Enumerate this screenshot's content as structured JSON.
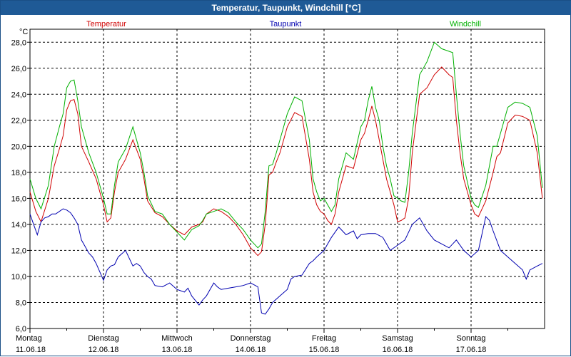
{
  "window": {
    "title": "Temperatur, Taupunkt, Windchill [°C]"
  },
  "colors": {
    "temperatur": "#d00000",
    "taupunkt": "#0000b0",
    "windchill": "#00b000",
    "titlebar": "#1f5a96",
    "grid": "#000000"
  },
  "chart_data": {
    "type": "line",
    "title": "Temperatur, Taupunkt, Windchill [°C]",
    "ylabel": "°C",
    "ylim": [
      6.0,
      29.0
    ],
    "xlim": [
      0,
      7
    ],
    "grid": true,
    "legend_placement": "top",
    "yticks": [
      "6,0",
      "8,0",
      "10,0",
      "12,0",
      "14,0",
      "16,0",
      "18,0",
      "20,0",
      "22,0",
      "24,0",
      "26,0",
      "28,0"
    ],
    "days": [
      {
        "name": "Montag",
        "date": "11.06.18"
      },
      {
        "name": "Dienstag",
        "date": "12.06.18"
      },
      {
        "name": "Mittwoch",
        "date": "13.06.18"
      },
      {
        "name": "Donnerstag",
        "date": "14.06.18"
      },
      {
        "name": "Freitag",
        "date": "15.06.18"
      },
      {
        "name": "Samstag",
        "date": "16.06.18"
      },
      {
        "name": "Sonntag",
        "date": "17.06.18"
      }
    ],
    "series": [
      {
        "name": "Temperatur",
        "x": [
          0,
          0.08,
          0.15,
          0.25,
          0.33,
          0.4,
          0.45,
          0.5,
          0.55,
          0.6,
          0.65,
          0.7,
          0.8,
          0.9,
          1.0,
          1.05,
          1.1,
          1.15,
          1.2,
          1.3,
          1.4,
          1.5,
          1.55,
          1.6,
          1.7,
          1.8,
          1.9,
          2.0,
          2.1,
          2.2,
          2.3,
          2.35,
          2.4,
          2.5,
          2.6,
          2.7,
          2.8,
          2.9,
          3.0,
          3.1,
          3.15,
          3.2,
          3.25,
          3.3,
          3.35,
          3.4,
          3.45,
          3.5,
          3.6,
          3.7,
          3.8,
          3.85,
          3.9,
          3.95,
          4.0,
          4.05,
          4.1,
          4.15,
          4.2,
          4.3,
          4.4,
          4.5,
          4.55,
          4.6,
          4.65,
          4.7,
          4.75,
          4.8,
          4.85,
          4.9,
          4.95,
          5.0,
          5.05,
          5.1,
          5.15,
          5.2,
          5.3,
          5.4,
          5.5,
          5.6,
          5.7,
          5.75,
          5.8,
          5.85,
          5.9,
          6.0,
          6.05,
          6.1,
          6.2,
          6.3,
          6.35,
          6.4,
          6.5,
          6.6,
          6.7,
          6.8,
          6.9,
          6.97
        ],
        "values": [
          16.5,
          15.0,
          14.2,
          16.0,
          18.5,
          19.8,
          20.8,
          22.8,
          23.5,
          23.6,
          22.5,
          20.0,
          18.8,
          17.5,
          15.5,
          14.2,
          14.5,
          16.5,
          18.0,
          19.0,
          20.5,
          19.0,
          17.5,
          15.8,
          14.9,
          14.6,
          14.0,
          13.5,
          13.2,
          13.8,
          14.0,
          14.2,
          14.8,
          15.2,
          15.0,
          14.6,
          14.0,
          13.2,
          12.2,
          11.6,
          11.9,
          14.0,
          17.8,
          18.0,
          18.8,
          19.5,
          20.5,
          21.5,
          22.6,
          22.3,
          19.0,
          16.5,
          15.5,
          15.0,
          14.8,
          14.3,
          14.0,
          14.8,
          16.5,
          18.5,
          18.3,
          20.5,
          21.0,
          22.0,
          23.1,
          22.0,
          20.5,
          19.0,
          17.5,
          16.5,
          15.5,
          14.2,
          14.3,
          14.5,
          16.0,
          19.5,
          24.0,
          24.5,
          25.5,
          26.1,
          25.5,
          25.3,
          22.0,
          19.5,
          17.5,
          15.5,
          14.8,
          14.6,
          15.8,
          18.0,
          19.2,
          19.5,
          21.8,
          22.4,
          22.3,
          22.0,
          19.5,
          16.0
        ]
      },
      {
        "name": "Taupunkt",
        "x": [
          0,
          0.05,
          0.1,
          0.15,
          0.2,
          0.25,
          0.3,
          0.35,
          0.4,
          0.45,
          0.5,
          0.55,
          0.6,
          0.65,
          0.7,
          0.75,
          0.8,
          0.85,
          0.9,
          1.0,
          1.05,
          1.1,
          1.15,
          1.2,
          1.3,
          1.4,
          1.45,
          1.5,
          1.55,
          1.6,
          1.65,
          1.7,
          1.8,
          1.9,
          2.0,
          2.1,
          2.15,
          2.2,
          2.3,
          2.35,
          2.4,
          2.5,
          2.55,
          2.6,
          2.7,
          2.8,
          2.9,
          3.0,
          3.1,
          3.15,
          3.2,
          3.25,
          3.3,
          3.4,
          3.5,
          3.55,
          3.6,
          3.7,
          3.8,
          3.85,
          3.9,
          4.0,
          4.05,
          4.1,
          4.2,
          4.3,
          4.4,
          4.45,
          4.5,
          4.6,
          4.7,
          4.8,
          4.9,
          5.0,
          5.1,
          5.2,
          5.3,
          5.4,
          5.5,
          5.6,
          5.7,
          5.8,
          5.9,
          6.0,
          6.1,
          6.2,
          6.25,
          6.3,
          6.4,
          6.5,
          6.6,
          6.7,
          6.75,
          6.8,
          6.9,
          6.97
        ],
        "values": [
          14.8,
          14.0,
          13.2,
          14.2,
          14.5,
          14.6,
          14.8,
          14.8,
          15.0,
          15.2,
          15.1,
          14.9,
          14.5,
          14.0,
          12.8,
          12.3,
          11.8,
          11.5,
          11.0,
          9.7,
          10.5,
          10.8,
          10.9,
          11.5,
          12.0,
          10.8,
          11.0,
          10.8,
          10.3,
          10.0,
          9.8,
          9.3,
          9.2,
          9.5,
          9.0,
          8.8,
          9.1,
          8.5,
          7.8,
          8.2,
          8.5,
          9.5,
          9.2,
          9.0,
          9.1,
          9.2,
          9.3,
          9.5,
          9.2,
          7.2,
          7.1,
          7.5,
          8.0,
          8.5,
          9.0,
          9.8,
          10.0,
          10.1,
          11.0,
          11.2,
          11.5,
          12.0,
          12.5,
          13.0,
          13.8,
          13.2,
          13.5,
          12.9,
          13.2,
          13.3,
          13.3,
          13.0,
          12.0,
          12.4,
          12.8,
          14.0,
          14.5,
          13.5,
          12.8,
          12.5,
          12.2,
          12.8,
          12.0,
          11.5,
          12.0,
          14.6,
          14.3,
          13.5,
          12.0,
          11.5,
          11.0,
          10.5,
          9.8,
          10.5,
          10.8,
          11.0
        ]
      },
      {
        "name": "Windchill",
        "x": [
          0,
          0.08,
          0.15,
          0.25,
          0.33,
          0.4,
          0.45,
          0.5,
          0.55,
          0.6,
          0.65,
          0.7,
          0.8,
          0.9,
          1.0,
          1.05,
          1.1,
          1.15,
          1.2,
          1.3,
          1.4,
          1.5,
          1.55,
          1.6,
          1.7,
          1.8,
          1.9,
          2.0,
          2.1,
          2.2,
          2.3,
          2.35,
          2.4,
          2.5,
          2.6,
          2.7,
          2.8,
          2.9,
          3.0,
          3.1,
          3.15,
          3.2,
          3.25,
          3.3,
          3.35,
          3.4,
          3.45,
          3.5,
          3.6,
          3.7,
          3.8,
          3.85,
          3.9,
          3.95,
          4.0,
          4.05,
          4.1,
          4.15,
          4.2,
          4.3,
          4.4,
          4.5,
          4.55,
          4.6,
          4.65,
          4.7,
          4.75,
          4.8,
          4.85,
          4.9,
          4.95,
          5.0,
          5.05,
          5.1,
          5.15,
          5.2,
          5.3,
          5.4,
          5.5,
          5.6,
          5.7,
          5.75,
          5.8,
          5.85,
          5.9,
          6.0,
          6.05,
          6.1,
          6.2,
          6.3,
          6.35,
          6.4,
          6.5,
          6.6,
          6.7,
          6.8,
          6.9,
          6.97
        ],
        "values": [
          17.5,
          16.0,
          15.2,
          17.0,
          20.0,
          21.5,
          22.5,
          24.5,
          25.0,
          25.1,
          23.5,
          21.5,
          19.5,
          18.0,
          16.0,
          14.8,
          14.8,
          17.0,
          18.8,
          19.8,
          21.5,
          19.5,
          18.0,
          16.2,
          15.0,
          14.8,
          14.0,
          13.4,
          12.8,
          13.6,
          13.9,
          14.3,
          14.8,
          15.0,
          15.2,
          14.9,
          14.2,
          13.6,
          12.8,
          12.2,
          12.5,
          15.0,
          18.5,
          18.6,
          19.5,
          20.5,
          21.5,
          22.5,
          23.8,
          23.5,
          20.5,
          17.5,
          16.5,
          15.8,
          16.0,
          15.5,
          15.0,
          15.5,
          17.5,
          19.5,
          19.0,
          21.5,
          22.0,
          23.5,
          24.6,
          23.0,
          22.0,
          20.0,
          18.5,
          17.5,
          16.2,
          16.0,
          15.8,
          15.7,
          18.0,
          21.0,
          25.5,
          26.5,
          28.0,
          27.5,
          27.3,
          27.2,
          24.0,
          21.0,
          18.5,
          16.0,
          15.5,
          15.3,
          17.0,
          20.0,
          20.0,
          21.0,
          23.0,
          23.4,
          23.3,
          23.0,
          20.8,
          16.8
        ]
      }
    ]
  }
}
